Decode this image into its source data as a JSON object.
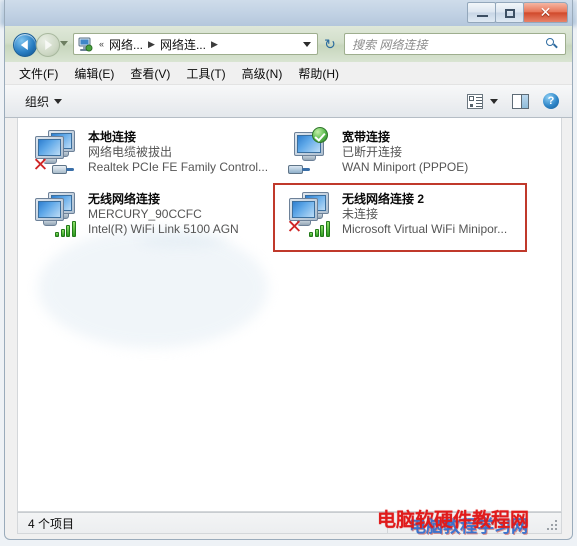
{
  "window": {
    "controls": {
      "minimize_label": "—",
      "restore_label": "❐",
      "close_label": "✕"
    }
  },
  "navbar": {
    "back_tooltip": "后退",
    "forward_tooltip": "前进",
    "breadcrumbs": [
      {
        "label": "«",
        "type": "overflow"
      },
      {
        "label": "网络...",
        "type": "crumb"
      },
      {
        "label": "网络连...",
        "type": "crumb"
      }
    ],
    "separator": "▶",
    "refresh_label": "↻",
    "search": {
      "value": "",
      "placeholder": "搜索 网络连接"
    }
  },
  "menubar": {
    "items": [
      {
        "label": "文件(F)"
      },
      {
        "label": "编辑(E)"
      },
      {
        "label": "查看(V)"
      },
      {
        "label": "工具(T)"
      },
      {
        "label": "高级(N)"
      },
      {
        "label": "帮助(H)"
      }
    ]
  },
  "toolbar": {
    "organize_label": "组织",
    "views_icon": "views-icon",
    "preview_pane_icon": "preview-pane-icon",
    "help_icon": "help-icon",
    "help_glyph": "?"
  },
  "connections": [
    {
      "name": "本地连接",
      "status": "网络电缆被拔出",
      "device": "Realtek PCIe FE Family Control...",
      "icon": "network-dual-monitor-icon",
      "badges": [
        "red-x-icon",
        "ethernet-plug-icon"
      ],
      "highlighted": false
    },
    {
      "name": "宽带连接",
      "status": "已断开连接",
      "device": "WAN Miniport (PPPOE)",
      "icon": "network-single-monitor-icon",
      "badges": [
        "green-check-icon",
        "broadband-plug-icon"
      ],
      "highlighted": false
    },
    {
      "name": "无线网络连接",
      "status": "MERCURY_90CCFC",
      "device": "Intel(R) WiFi Link 5100 AGN",
      "icon": "network-dual-monitor-icon",
      "badges": [
        "wifi-bars-icon"
      ],
      "highlighted": false
    },
    {
      "name": "无线网络连接 2",
      "status": "未连接",
      "device": "Microsoft Virtual WiFi Minipor...",
      "icon": "network-dual-monitor-icon",
      "badges": [
        "red-x-icon",
        "wifi-bars-icon"
      ],
      "highlighted": true
    }
  ],
  "statusbar": {
    "item_count_text": "4 个项目"
  },
  "watermarks": {
    "red_text": "电脑软硬件教程网",
    "blue_text": "电脑教程学习网"
  },
  "colors": {
    "highlight_border": "#c0392b",
    "watermark_red": "#e01b1b",
    "watermark_blue": "#2f6fd0",
    "close_button": "#d14a2c",
    "signal_green": "#2f9b21"
  }
}
